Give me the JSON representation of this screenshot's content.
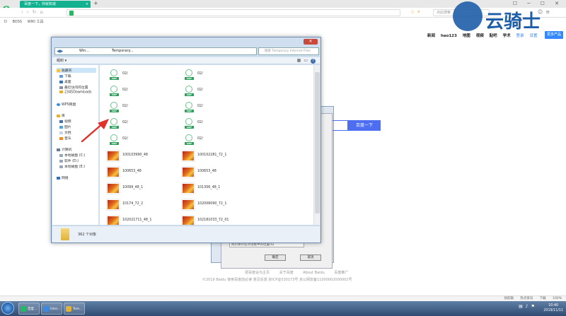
{
  "browser": {
    "tab_title": "百度一下，你就知道",
    "tab_close": "×",
    "new_tab": "+",
    "search_placeholder": "点此搜索",
    "bookmarks": [
      "D",
      "BOSS",
      "WIKI 工具"
    ],
    "window_controls": "☐ ─ ☐ ✕"
  },
  "watermark": {
    "text": "云骑士"
  },
  "baidu": {
    "nav": [
      "新闻",
      "hao123",
      "地图",
      "视频",
      "贴吧",
      "学术"
    ],
    "nav_login": "登录",
    "nav_settings": "设置",
    "more_products": "更多产品",
    "search_button": "百度一下",
    "footer_links": [
      "把百度设为主页",
      "关于百度",
      "About Baidu",
      "百度推广"
    ],
    "footer_legal": "©2019 Baidu 使用百度前必读 意见反馈 京ICP证030173号  京公网安备11000002000001号"
  },
  "bg_dialog": {
    "field_text": "网页保存后对话框中的位置(S)",
    "ok": "确定",
    "cancel": "取消"
  },
  "file_dialog": {
    "path_root": "Win...",
    "path_folder": "Temporary...",
    "search_placeholder": "搜索 Temporary Internet Files",
    "organize": "组织 ▾",
    "help": "?",
    "close": "✕",
    "sidebar": {
      "favorites_header": "收藏夹",
      "favorites": [
        "下载",
        "桌面",
        "最近访问的位置",
        "2345Downloads"
      ],
      "cloud": "WPS网盘",
      "libraries_header": "库",
      "libraries": [
        "视频",
        "图片",
        "文档",
        "音乐"
      ],
      "computer_header": "计算机",
      "drives": [
        "本地磁盘 (C:)",
        "软件 (D:)",
        "本地磁盘 (E:)"
      ],
      "network": "网络"
    },
    "files": [
      {
        "name": "02/",
        "type": "swf"
      },
      {
        "name": "02/",
        "type": "swf"
      },
      {
        "name": "02/",
        "type": "swf"
      },
      {
        "name": "02/",
        "type": "swf"
      },
      {
        "name": "02/",
        "type": "swf"
      },
      {
        "name": "02/",
        "type": "swf"
      },
      {
        "name": "02/",
        "type": "swf"
      },
      {
        "name": "02/",
        "type": "swf"
      },
      {
        "name": "02/",
        "type": "swf"
      },
      {
        "name": "02/",
        "type": "swf"
      },
      {
        "name": "100103990_48",
        "type": "img"
      },
      {
        "name": "100102281_72_1",
        "type": "img"
      },
      {
        "name": "100653_48",
        "type": "img"
      },
      {
        "name": "100653_48",
        "type": "img"
      },
      {
        "name": "10099_48_1",
        "type": "img"
      },
      {
        "name": "101306_48_1",
        "type": "img"
      },
      {
        "name": "10174_72_2",
        "type": "img"
      },
      {
        "name": "102006090_72_1",
        "type": "img"
      },
      {
        "name": "102021711_48_1",
        "type": "img"
      },
      {
        "name": "102181033_72_01",
        "type": "img"
      }
    ],
    "swf_tag": "SWF",
    "status_count": "362 个对象"
  },
  "statusbar": {
    "items": [
      "快剪辑",
      "热点资讯",
      "下载",
      "100%"
    ]
  },
  "taskbar": {
    "tasks": [
      "百度...",
      "Inter...",
      "Tem..."
    ],
    "time": "10:40",
    "date": "2019/11/11"
  },
  "colors": {
    "tab_active": "#13b18f",
    "baidu_blue": "#4e6ef2",
    "swf_green": "#2aa35a",
    "arrow_red": "#e0322a"
  }
}
